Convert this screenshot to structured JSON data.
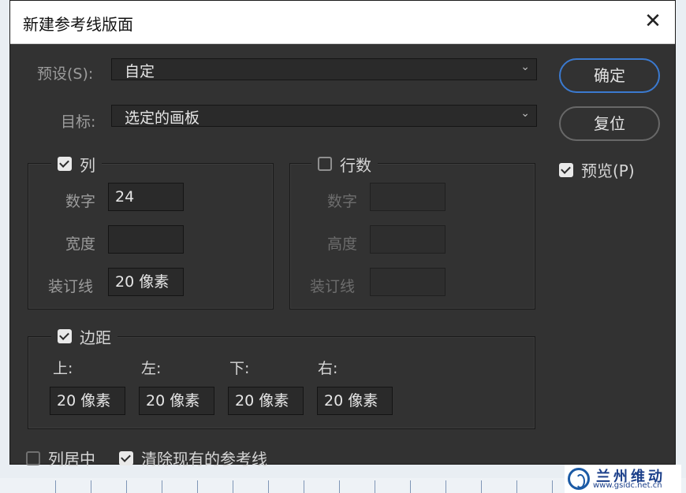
{
  "dialog": {
    "title": "新建参考线版面",
    "close_glyph": "✕"
  },
  "preset": {
    "label": "预设(S):",
    "value": "自定"
  },
  "target": {
    "label": "目标:",
    "value": "选定的画板"
  },
  "buttons": {
    "ok": "确定",
    "reset": "复位"
  },
  "preview": {
    "label": "预览(P)",
    "checked": true
  },
  "columns": {
    "legend": "列",
    "checked": true,
    "number_label": "数字",
    "number_value": "24",
    "width_label": "宽度",
    "width_value": "",
    "gutter_label": "装订线",
    "gutter_value": "20 像素"
  },
  "rows": {
    "legend": "行数",
    "checked": false,
    "number_label": "数字",
    "number_value": "",
    "height_label": "高度",
    "height_value": "",
    "gutter_label": "装订线",
    "gutter_value": ""
  },
  "margin": {
    "legend": "边距",
    "checked": true,
    "top_label": "上:",
    "top_value": "20 像素",
    "left_label": "左:",
    "left_value": "20 像素",
    "bottom_label": "下:",
    "bottom_value": "20 像素",
    "right_label": "右:",
    "right_value": "20 像素"
  },
  "center_columns": {
    "label": "列居中",
    "checked": false
  },
  "clear_guides": {
    "label": "清除现有的参考线",
    "checked": true
  },
  "watermark": {
    "name": "兰州维动",
    "url": "www.gsidc.net.cn"
  },
  "colors": {
    "panel": "#323232",
    "accent": "#3b7ad0",
    "ruler_tick": "#7f96b6"
  },
  "icons": {
    "close": "close-icon",
    "dropdown": "chevron-down-icon",
    "check": "checkmark-icon"
  }
}
